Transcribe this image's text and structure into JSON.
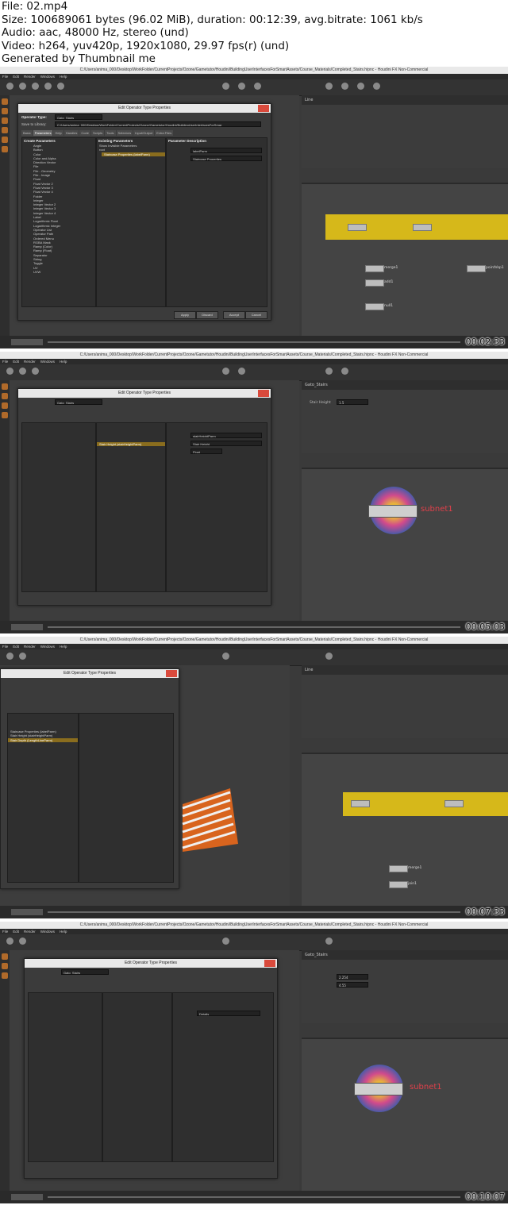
{
  "header": {
    "file": "File: 02.mp4",
    "size": "Size: 100689061 bytes (96.02 MiB), duration: 00:12:39, avg.bitrate: 1061 kb/s",
    "audio": "Audio: aac, 48000 Hz, stereo (und)",
    "video": "Video: h264, yuv420p, 1920x1080, 29.97 fps(r) (und)",
    "generator": "Generated by Thumbnail me"
  },
  "app": {
    "window_title": "C:/Users/anima_000/Desktop/WorkFolder/CurrentProjects/Ozone/Gametutor/Houdini/BuildingUserInterfacesForSmartAssets/Course_Materials/Completed_Stairs.hipnc - Houdini FX Non-Commercial",
    "menu": [
      "File",
      "Edit",
      "Render",
      "Windows",
      "Help"
    ],
    "watermark": "Non-Commercial Edition"
  },
  "frames": [
    {
      "timestamp": "00:02:33",
      "dialog_title": "Edit Operator Type Properties",
      "operator_type_label": "Operator Type:",
      "operator_type": "Gato_Stairs",
      "save_label": "Save to Library:",
      "save_path": "C:/Users/anima_000/Desktop/WorkFolder/CurrentProjects/Ozone/Gametutor/Houdini/BuildingUserInterfacesForSmar",
      "tabs": [
        "Basic",
        "Parameters",
        "Help",
        "Handles",
        "Code",
        "Scripts",
        "Tools",
        "Selectors",
        "Input/Output",
        "Extra Files"
      ],
      "create_params_title": "Create Parameters",
      "existing_params_title": "Existing Parameters",
      "param_desc_title": "Parameter Description",
      "create_params": [
        "Angle",
        "Button",
        "Color",
        "Color and Alpha",
        "Direction Vector",
        "File",
        "File - Geometry",
        "File - Image",
        "Float",
        "Float Vector 2",
        "Float Vector 3",
        "Float Vector 4",
        "Folder",
        "Integer",
        "Integer Vector 2",
        "Integer Vector 3",
        "Integer Vector 4",
        "Label",
        "Logarithmic Float",
        "Logarithmic Integer",
        "Operator List",
        "Operator Path",
        "Ordered Menu",
        "RGBA Mask",
        "Ramp (Color)",
        "Ramp (Float)",
        "Separator",
        "String",
        "Toggle",
        "UV",
        "UVW"
      ],
      "existing_params": [
        "Show Invisible Parameters",
        "root",
        "Staircase Properties (labelParm)"
      ],
      "selected_param": "Staircase Properties (labelParm)",
      "desc_name": "labelParm",
      "desc_label": "Staircase Properties",
      "buttons": [
        "Apply",
        "Discard",
        "Accept",
        "Cancel"
      ],
      "network_nodes": [
        "merge1",
        "pointVop1",
        "add1",
        "null1"
      ]
    },
    {
      "timestamp": "00:05:03",
      "dialog_title": "Edit Operator Type Properties",
      "operator_type": "Gato_Stairs",
      "selected_param": "Stair Height (stairHeightParm)",
      "desc_name": "stairHeightParm",
      "desc_label": "Stair Height",
      "desc_type": "Float",
      "stair_height_label": "Stair Height",
      "stair_height_value": "1.5",
      "subnet_label": "subnet1"
    },
    {
      "timestamp": "00:07:33",
      "dialog_title": "Edit Operator Type Properties",
      "existing_params": [
        "Staircase Properties (labelParm)",
        "Stair Height (stairHeightParm)",
        "Stair Depth (LengthLineParm)"
      ],
      "network_nodes": [
        "merge1",
        "join1"
      ]
    },
    {
      "timestamp": "00:10:07",
      "dialog_title": "Edit Operator Type Properties",
      "operator_type": "Gato_Stairs",
      "folder_label": "Details",
      "stair_height_value": "2.254",
      "stair_depth_value": "4.55",
      "subnet_label": "subnet1"
    }
  ]
}
